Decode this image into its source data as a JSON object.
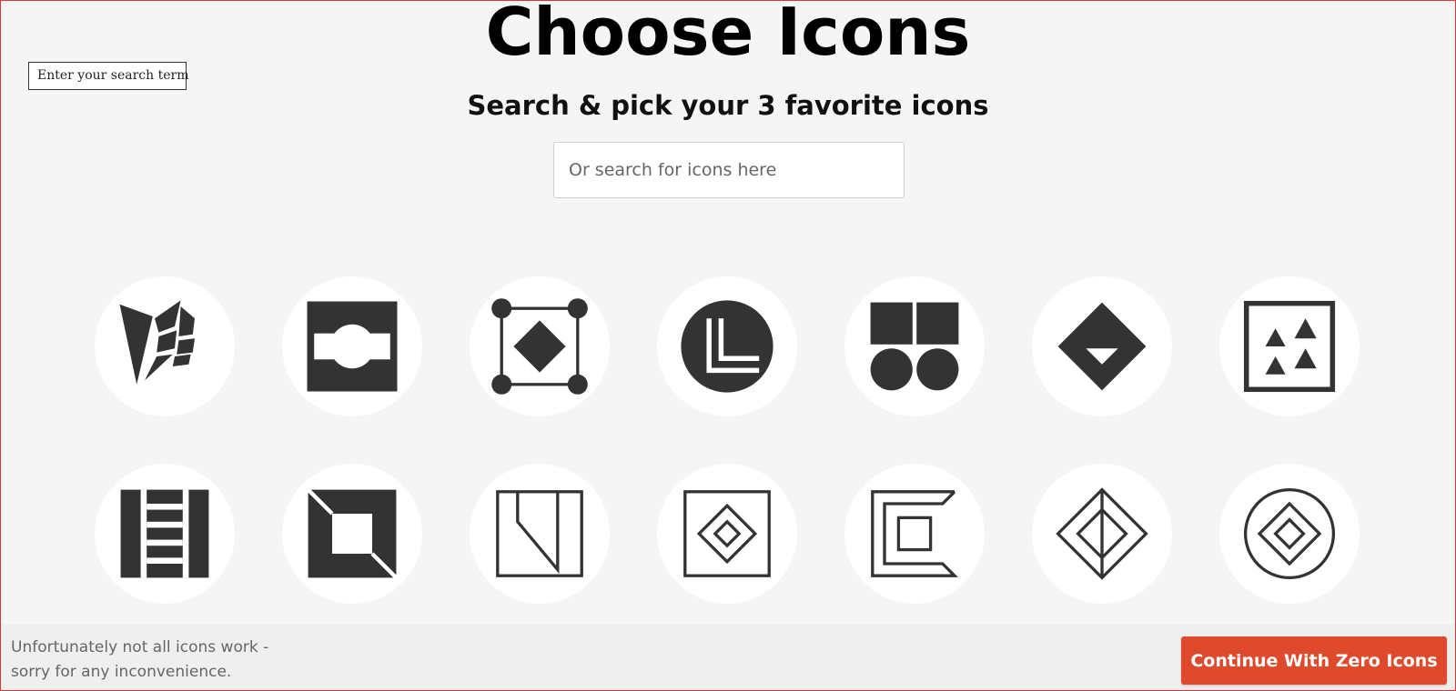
{
  "search_term_box": {
    "label": "Enter your search term"
  },
  "header": {
    "title": "Choose Icons",
    "subtitle": "Search & pick your 3 favorite icons"
  },
  "search": {
    "placeholder": "Or search for icons here",
    "value": ""
  },
  "icons": [
    {
      "name": "abstract-shard-icon"
    },
    {
      "name": "square-circle-cutout-icon"
    },
    {
      "name": "diamond-frame-corners-icon"
    },
    {
      "name": "circle-corner-lines-icon"
    },
    {
      "name": "squares-circles-icon"
    },
    {
      "name": "diamond-triangle-icon"
    },
    {
      "name": "triangles-square-icon"
    },
    {
      "name": "ladder-grid-icon"
    },
    {
      "name": "square-cutout-frame-icon"
    },
    {
      "name": "square-slash-outline-icon"
    },
    {
      "name": "nested-diamonds-square-icon"
    },
    {
      "name": "bracket-square-icon"
    },
    {
      "name": "split-diamond-icon"
    },
    {
      "name": "circle-nested-diamonds-icon"
    }
  ],
  "footer": {
    "note": "Unfortunately not all icons work - sorry for any inconvenience.",
    "continue_label": "Continue With Zero Icons"
  },
  "colors": {
    "accent": "#e04a2c",
    "icon": "#333333",
    "tile": "#ffffff",
    "background": "#f5f5f5"
  }
}
